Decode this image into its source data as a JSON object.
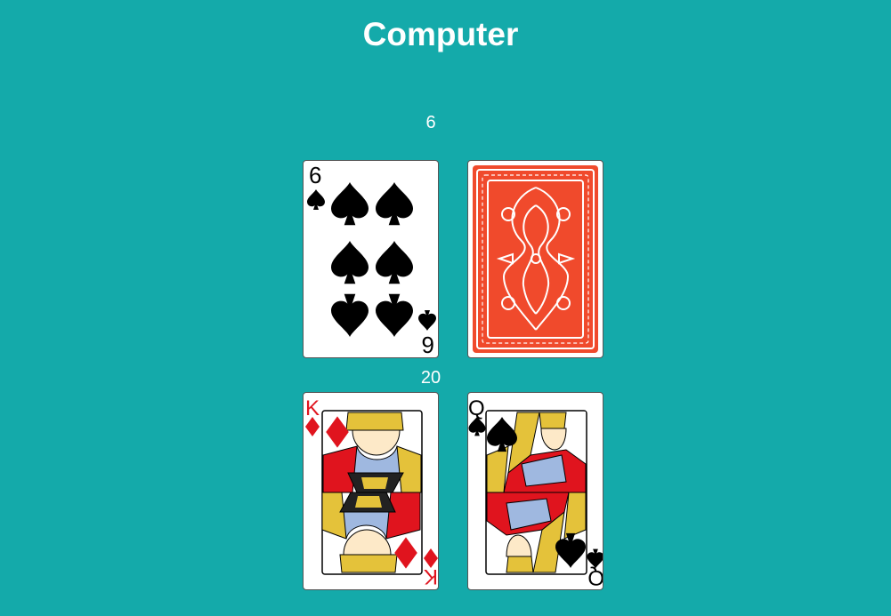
{
  "header": {
    "title": "Computer"
  },
  "dealer": {
    "score": "6",
    "cards": [
      {
        "rank": "6",
        "suit": "spades",
        "face_up": true
      },
      {
        "face_up": false
      }
    ]
  },
  "player": {
    "score": "20",
    "cards": [
      {
        "rank": "K",
        "suit": "diamonds",
        "face_up": true
      },
      {
        "rank": "Q",
        "suit": "spades",
        "face_up": true
      }
    ]
  },
  "colors": {
    "table": "#14aaaa",
    "card_back": "#f04a2c",
    "red_suit": "#e0141e",
    "black_suit": "#000000"
  }
}
